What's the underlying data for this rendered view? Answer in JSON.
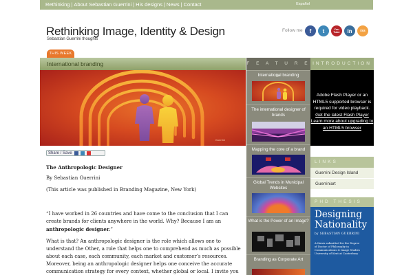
{
  "topnav": {
    "items": [
      "Rethinking",
      "About Sebastian Guerrini",
      "His designs",
      "News",
      "Contact"
    ],
    "language": "Español"
  },
  "site": {
    "title": "Rethinking Image, Identity & Design",
    "subtitle": "Sebastian Guerrini thoughts"
  },
  "social": {
    "follow_label": "Follow me",
    "icons": [
      "f",
      "t",
      "You Tube",
      "in",
      "rss"
    ]
  },
  "tab": {
    "label": "THIS WEEK"
  },
  "featured": {
    "heading": "International branding",
    "caption": "Guerrini"
  },
  "share": {
    "label": "Share / Save"
  },
  "article": {
    "title": "The Anthropologic Designer",
    "byline": "By Sebastian Guerrini",
    "publication": "(This article was published in Branding Magazine, New York)",
    "quote_lead": "“I have worked in 26 countries and have come to the conclusion that I can create brands for clients anywhere in the world. Why? Because I am an ",
    "quote_bold": "anthropologic designer.",
    "quote_end": "”",
    "paragraph": "What is that? An anthropologic designer is the role which allows one to understand the Other, a role that helps one to comprehend as much as possible about each case, each community, each market and customer’s resources. Moreover, being an anthropologic designer helps one conceive the accurate communication strategy for every context, whether global or local. I invite you to this, then, my stage of action."
  },
  "features": {
    "heading": "F E A T U R E S",
    "items": [
      {
        "label": "International branding"
      },
      {
        "label": "The international designer of brands"
      },
      {
        "label": "Mapping the core of a brand"
      },
      {
        "label": "Global Trends in Municipal Websites"
      },
      {
        "label": "What is the Power of an Image?"
      },
      {
        "label": "Branding as Corporate Art"
      }
    ]
  },
  "intro": {
    "heading": "INTRODUCTION",
    "video_text": "Adobe Flash Player or an HTML5 supported browser is required for video playback.",
    "video_link1": "Get the latest Flash Player",
    "video_link2": "Learn more about upgrading to an HTML5 browser"
  },
  "links": {
    "heading": "LINKS",
    "items": [
      "Guerrini Design Island",
      "Guerriniart"
    ]
  },
  "phd": {
    "heading": "PHD THESIS",
    "book_title_1": "Designing",
    "book_title_2": "Nationality",
    "book_author": "by SEBASTIAN GUERRINI",
    "book_desc_1": "A thesis submitted for the Degree",
    "book_desc_2": "of Doctor of Philosophy in",
    "book_desc_3": "Communications & Image Studies",
    "book_desc_4": "University of Kent at Canterbury"
  },
  "colors": {
    "topbar": "#a9b88c",
    "accent_orange": "#e8782c",
    "features_bg": "#8a8a7c",
    "book_blue": "#1e5aa0"
  }
}
